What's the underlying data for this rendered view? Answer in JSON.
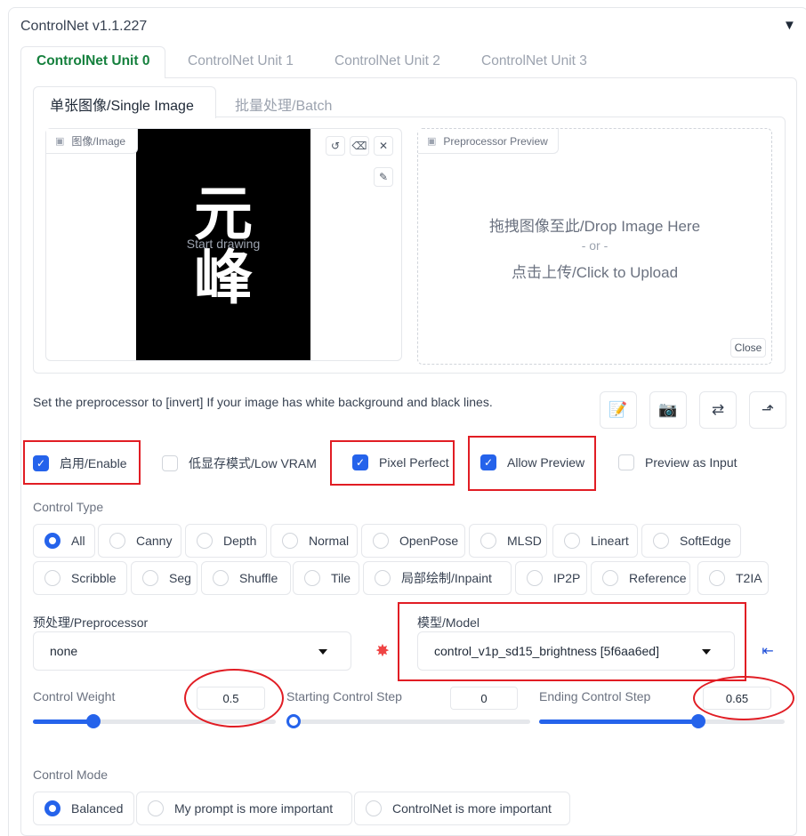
{
  "header": {
    "title": "ControlNet v1.1.227"
  },
  "unit_tabs": [
    "ControlNet Unit 0",
    "ControlNet Unit 1",
    "ControlNet Unit 2",
    "ControlNet Unit 3"
  ],
  "sub_tabs": [
    "单张图像/Single Image",
    "批量处理/Batch"
  ],
  "image_panel": {
    "label": "图像/Image",
    "canvas_chars": [
      "元",
      "峰"
    ],
    "start_drawing": "Start drawing"
  },
  "preview_panel": {
    "label": "Preprocessor Preview",
    "drop_text": "拖拽图像至此/Drop Image Here",
    "or_text": "- or -",
    "upload_text": "点击上传/Click to Upload",
    "close_label": "Close"
  },
  "hint": "Set the preprocessor to [invert] If your image has white background and black lines.",
  "checkboxes": [
    {
      "label": "启用/Enable",
      "checked": true
    },
    {
      "label": "低显存模式/Low VRAM",
      "checked": false
    },
    {
      "label": "Pixel Perfect",
      "checked": true
    },
    {
      "label": "Allow Preview",
      "checked": true
    },
    {
      "label": "Preview as Input",
      "checked": false
    }
  ],
  "control_type": {
    "label": "Control Type",
    "selected": "All",
    "row1": [
      "All",
      "Canny",
      "Depth",
      "Normal",
      "OpenPose",
      "MLSD",
      "Lineart",
      "SoftEdge"
    ],
    "row2": [
      "Scribble",
      "Seg",
      "Shuffle",
      "Tile",
      "局部绘制/Inpaint",
      "IP2P",
      "Reference",
      "T2IA"
    ]
  },
  "preprocessor": {
    "label": "预处理/Preprocessor",
    "value": "none"
  },
  "model": {
    "label": "模型/Model",
    "value": "control_v1p_sd15_brightness [5f6aa6ed]"
  },
  "sliders": {
    "weight": {
      "label": "Control Weight",
      "value": "0.5",
      "min": 0,
      "max": 2,
      "fraction": 0.25
    },
    "start": {
      "label": "Starting Control Step",
      "value": "0",
      "min": 0,
      "max": 1,
      "fraction": 0.0
    },
    "end": {
      "label": "Ending Control Step",
      "value": "0.65",
      "min": 0,
      "max": 1,
      "fraction": 0.65
    }
  },
  "control_mode": {
    "label": "Control Mode",
    "selected": "Balanced",
    "options": [
      "Balanced",
      "My prompt is more important",
      "ControlNet is more important"
    ]
  },
  "colors": {
    "accent": "#2563eb",
    "active_tab": "#15803d",
    "annotation": "#e11d24"
  },
  "icons": [
    "image-icon",
    "undo-icon",
    "eraser-icon",
    "close-icon",
    "brush-icon",
    "notepad-icon",
    "camera-icon",
    "swap-icon",
    "send-icon",
    "explosion-icon",
    "send-dimensions-icon"
  ]
}
